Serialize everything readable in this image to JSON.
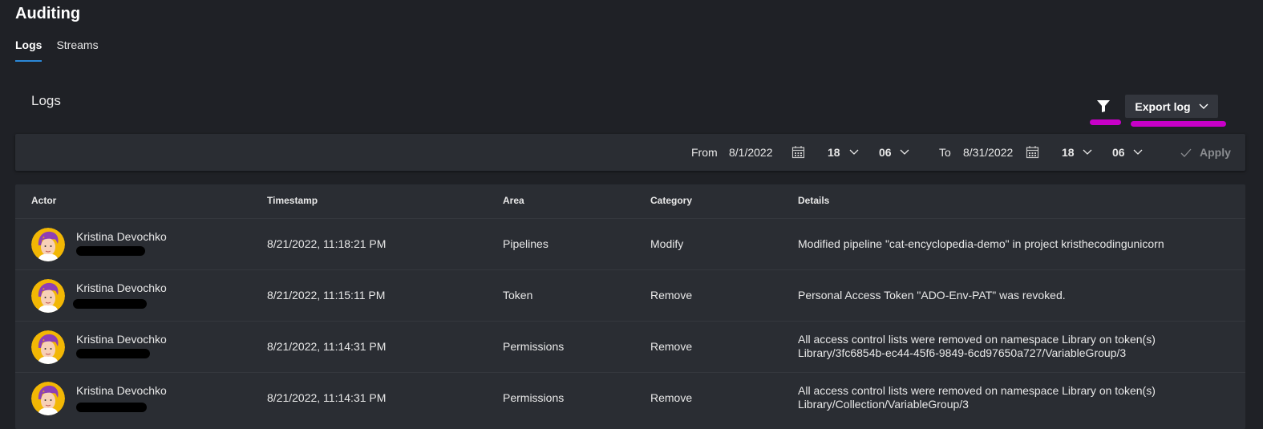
{
  "page": {
    "title": "Auditing"
  },
  "tabs": [
    {
      "label": "Logs",
      "active": true
    },
    {
      "label": "Streams",
      "active": false
    }
  ],
  "section": {
    "title": "Logs"
  },
  "toolbar": {
    "export_label": "Export log",
    "filter_icon": "filter-icon"
  },
  "filter_bar": {
    "from_label": "From",
    "from_date": "8/1/2022",
    "from_hour": "18",
    "from_minute": "06",
    "to_label": "To",
    "to_date": "8/31/2022",
    "to_hour": "18",
    "to_minute": "06",
    "apply_label": "Apply"
  },
  "table": {
    "columns": [
      "Actor",
      "Timestamp",
      "Area",
      "Category",
      "Details"
    ],
    "rows": [
      {
        "actor": "Kristina Devochko",
        "timestamp": "8/21/2022, 11:18:21 PM",
        "area": "Pipelines",
        "category": "Modify",
        "details_line1": "Modified pipeline \"cat-encyclopedia-demo\" in project kristhecodingunicorn",
        "details_line2": ""
      },
      {
        "actor": "Kristina Devochko",
        "timestamp": "8/21/2022, 11:15:11 PM",
        "area": "Token",
        "category": "Remove",
        "details_line1": "Personal Access Token \"ADO-Env-PAT\" was revoked.",
        "details_line2": ""
      },
      {
        "actor": "Kristina Devochko",
        "timestamp": "8/21/2022, 11:14:31 PM",
        "area": "Permissions",
        "category": "Remove",
        "details_line1": "All access control lists were removed on namespace Library on token(s)",
        "details_line2": "Library/3fc6854b-ec44-45f6-9849-6cd97650a727/VariableGroup/3"
      },
      {
        "actor": "Kristina Devochko",
        "timestamp": "8/21/2022, 11:14:31 PM",
        "area": "Permissions",
        "category": "Remove",
        "details_line1": "All access control lists were removed on namespace Library on token(s)",
        "details_line2": "Library/Collection/VariableGroup/3"
      }
    ]
  },
  "colors": {
    "accent": "#2b88d8",
    "background": "#1f2126",
    "panel": "#2a2d33",
    "annotation": "#c800c8"
  }
}
